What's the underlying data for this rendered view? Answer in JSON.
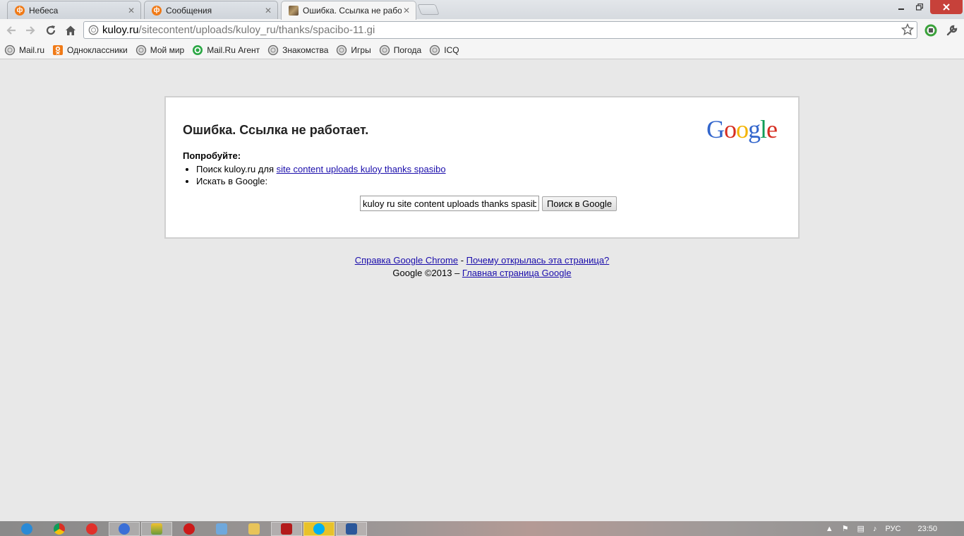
{
  "tabs": [
    {
      "title": "Небеса",
      "favicon": "odnoklassniki-icon",
      "active": false
    },
    {
      "title": "Сообщения",
      "favicon": "odnoklassniki-icon",
      "active": false
    },
    {
      "title": "Ошибка. Ссылка не работ",
      "favicon": "page-icon",
      "active": true
    }
  ],
  "address_bar": {
    "host": "kuloy.ru",
    "path": "/sitecontent/uploads/kuloy_ru/thanks/spacibo-11.gi"
  },
  "bookmarks": [
    {
      "label": "Mail.ru",
      "icon": "globe-icon"
    },
    {
      "label": "Одноклассники",
      "icon": "odnoklassniki-icon"
    },
    {
      "label": "Мой мир",
      "icon": "globe-icon"
    },
    {
      "label": "Mail.Ru Агент",
      "icon": "agent-icon"
    },
    {
      "label": "Знакомства",
      "icon": "globe-icon"
    },
    {
      "label": "Игры",
      "icon": "globe-icon"
    },
    {
      "label": "Погода",
      "icon": "globe-icon"
    },
    {
      "label": "ICQ",
      "icon": "globe-icon"
    }
  ],
  "error_page": {
    "title": "Ошибка. Ссылка не работает.",
    "logo_text": "Google",
    "logo_letters": [
      {
        "ch": "G",
        "color": "#3366cc"
      },
      {
        "ch": "o",
        "color": "#d62d20"
      },
      {
        "ch": "o",
        "color": "#f4b400"
      },
      {
        "ch": "g",
        "color": "#3366cc"
      },
      {
        "ch": "l",
        "color": "#109d58"
      },
      {
        "ch": "e",
        "color": "#d62d20"
      }
    ],
    "try_label": "Попробуйте:",
    "suggestion_1_prefix": "Поиск kuloy.ru для",
    "suggestion_1_link": "site content uploads kuloy thanks spasibo",
    "suggestion_2": "Искать в Google:",
    "search_value": "kuloy ru site content uploads thanks spasibo",
    "search_button": "Поиск в Google"
  },
  "footer": {
    "help_link": "Справка Google Chrome",
    "separator": " - ",
    "why_link": "Почему открылась эта страница?",
    "copyright": "Google ©2013 – ",
    "home_link": "Главная страница Google"
  },
  "taskbar": {
    "language": "РУС",
    "time": "23:50",
    "items": [
      "ie-icon",
      "chrome-icon",
      "yandex-icon",
      "bird-icon",
      "taxi-icon",
      "opera-icon",
      "remote-icon",
      "folder-icon",
      "acrobat-icon",
      "skype-icon",
      "word-icon"
    ]
  },
  "colors": {
    "link": "#1a0dab",
    "close_button": "#c7413a",
    "page_bg": "#e8e8e8"
  }
}
